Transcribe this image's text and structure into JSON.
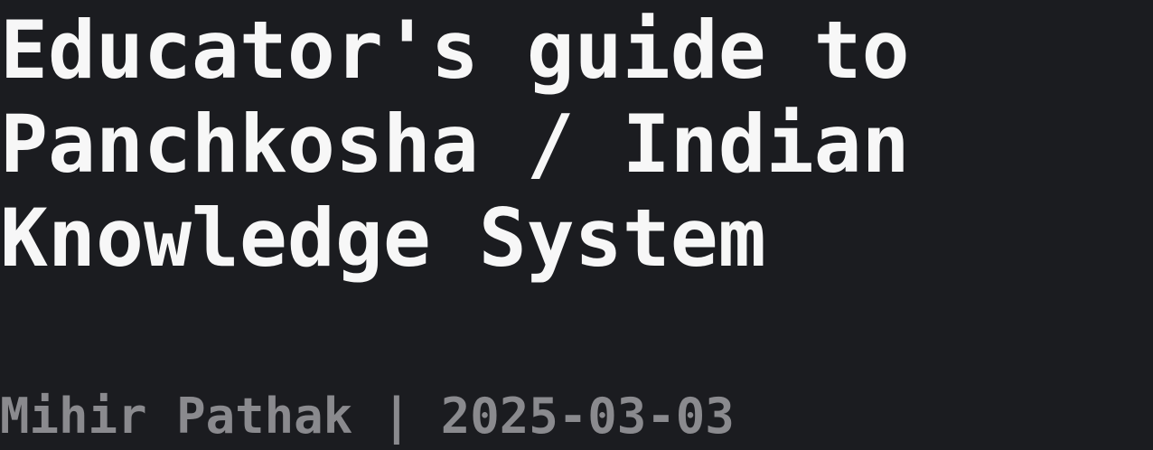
{
  "post": {
    "title": "Educator's guide to Panchkosha / Indian Knowledge System",
    "author": "Mihir Pathak",
    "separator": "|",
    "date": "2025-03-03"
  },
  "colors": {
    "background": "#1b1c20",
    "title": "#f7f7f7",
    "meta": "#8a8a8e"
  }
}
